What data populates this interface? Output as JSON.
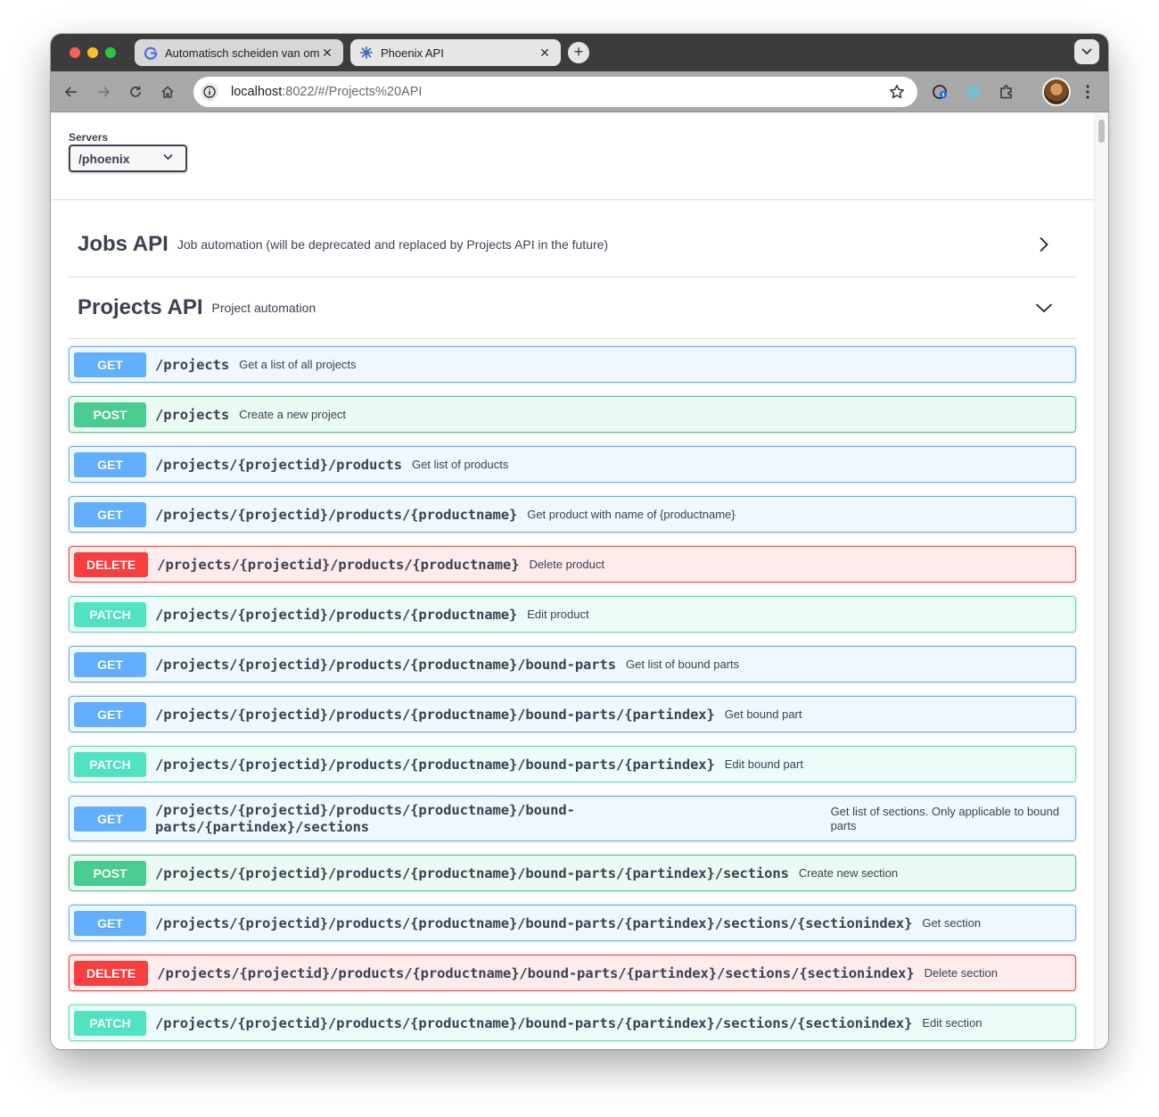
{
  "browser": {
    "tabs": [
      {
        "title": "Automatisch scheiden van om",
        "active": false
      },
      {
        "title": "Phoenix API",
        "active": true
      }
    ],
    "url_host": "localhost",
    "url_rest": ":8022/#/Projects%20API"
  },
  "servers": {
    "label": "Servers",
    "selected": "/phoenix"
  },
  "tags": [
    {
      "name": "Jobs API",
      "description": "Job automation (will be deprecated and replaced by Projects API in the future)",
      "expanded": false
    },
    {
      "name": "Projects API",
      "description": "Project automation",
      "expanded": true
    }
  ],
  "operations": [
    {
      "method": "GET",
      "path": "/projects",
      "summary": "Get a list of all projects"
    },
    {
      "method": "POST",
      "path": "/projects",
      "summary": "Create a new project"
    },
    {
      "method": "GET",
      "path": "/projects/{projectid}/products",
      "summary": "Get list of products"
    },
    {
      "method": "GET",
      "path": "/projects/{projectid}/products/{productname}",
      "summary": "Get product with name of {productname}"
    },
    {
      "method": "DELETE",
      "path": "/projects/{projectid}/products/{productname}",
      "summary": "Delete product"
    },
    {
      "method": "PATCH",
      "path": "/projects/{projectid}/products/{productname}",
      "summary": "Edit product"
    },
    {
      "method": "GET",
      "path": "/projects/{projectid}/products/{productname}/bound-parts",
      "summary": "Get list of bound parts"
    },
    {
      "method": "GET",
      "path": "/projects/{projectid}/products/{productname}/bound-parts/{partindex}",
      "summary": "Get bound part"
    },
    {
      "method": "PATCH",
      "path": "/projects/{projectid}/products/{productname}/bound-parts/{partindex}",
      "summary": "Edit bound part"
    },
    {
      "method": "GET",
      "path": "/projects/{projectid}/products/{productname}/bound-parts/{partindex}/sections",
      "summary": "Get list of sections. Only applicable to bound parts"
    },
    {
      "method": "POST",
      "path": "/projects/{projectid}/products/{productname}/bound-parts/{partindex}/sections",
      "summary": "Create new section"
    },
    {
      "method": "GET",
      "path": "/projects/{projectid}/products/{productname}/bound-parts/{partindex}/sections/{sectionindex}",
      "summary": "Get section"
    },
    {
      "method": "DELETE",
      "path": "/projects/{projectid}/products/{productname}/bound-parts/{partindex}/sections/{sectionindex}",
      "summary": "Delete section"
    },
    {
      "method": "PATCH",
      "path": "/projects/{projectid}/products/{productname}/bound-parts/{partindex}/sections/{sectionindex}",
      "summary": "Edit section"
    }
  ]
}
